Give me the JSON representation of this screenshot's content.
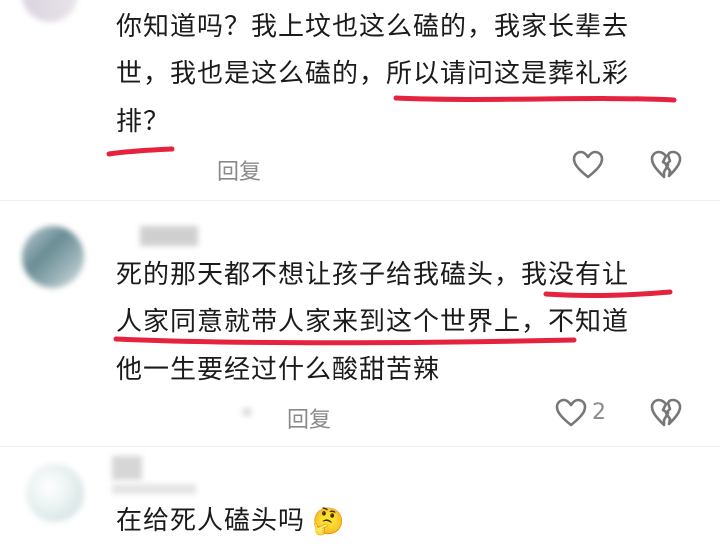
{
  "comments": [
    {
      "lines": [
        "你知道吗？我上坟也这么磕的，我家长辈去",
        "世，我也是这么磕的，所以请问这是葬礼彩",
        "排？"
      ],
      "reply_label": "回复",
      "like_count": ""
    },
    {
      "lines": [
        "死的那天都不想让孩子给我磕头，我没有让",
        "人家同意就带人家来到这个世界上，不知道",
        "他一生要经过什么酸甜苦辣"
      ],
      "reply_label": "回复",
      "like_count": "2"
    },
    {
      "lines": [
        "在给死人磕头吗"
      ],
      "emoji": "🤔"
    }
  ],
  "colors": {
    "underline": "#e5233f",
    "icon": "#777777",
    "meta": "#8a8a8a"
  },
  "icons": [
    "heart-outline-icon",
    "broken-heart-icon"
  ]
}
